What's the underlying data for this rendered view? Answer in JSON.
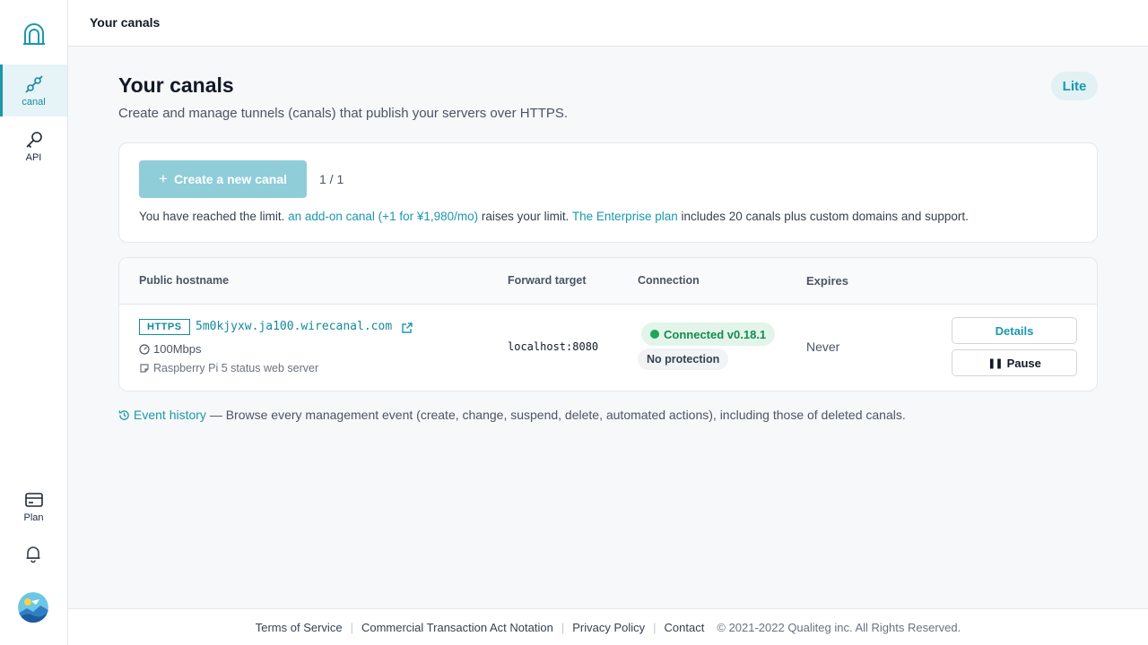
{
  "sidebar": {
    "logo_icon": "arch-logo-icon",
    "items": [
      {
        "label": "canal",
        "icon": "link-plug-icon",
        "active": true
      },
      {
        "label": "API",
        "icon": "key-icon",
        "active": false
      },
      {
        "label": "Plan",
        "icon": "card-icon",
        "active": false
      }
    ],
    "bell_icon": "bell-icon",
    "avatar_icon": "avatar-icon"
  },
  "topbar": {
    "title": "Your canals"
  },
  "main": {
    "title": "Your canals",
    "subtitle": "Create and manage tunnels (canals) that publish your servers over HTTPS.",
    "plan_badge": "Lite",
    "create": {
      "button_label": "Create a new canal",
      "count": "1 / 1",
      "limit_prefix": "You have reached the limit. ",
      "addon_link": "an add-on canal (+1 for ¥1,980/mo)",
      "limit_middle": " raises your limit. ",
      "enterprise_link": "The Enterprise plan",
      "limit_suffix": " includes 20 canals plus custom domains and support."
    },
    "table": {
      "headers": {
        "host": "Public hostname",
        "forward": "Forward target",
        "connection": "Connection",
        "expires": "Expires"
      },
      "rows": [
        {
          "protocol": "HTTPS",
          "hostname": "5m0kjyxw.ja100.wirecanal.com",
          "speed": "100Mbps",
          "description": "Raspberry Pi 5 status web server",
          "forward": "localhost:8080",
          "connection_status": "Connected v0.18.1",
          "protection": "No protection",
          "expires": "Never",
          "details_label": "Details",
          "pause_label": "Pause"
        }
      ]
    },
    "events": {
      "link": "Event history",
      "text": " — Browse every management event (create, change, suspend, delete, automated actions), including those of deleted canals."
    }
  },
  "footer": {
    "links": [
      "Terms of Service",
      "Commercial Transaction Act Notation",
      "Privacy Policy",
      "Contact"
    ],
    "copyright": "© 2021-2022 Qualiteg inc. All Rights Reserved."
  },
  "colors": {
    "accent": "#1a98ad",
    "connected": "#1ea55a",
    "create_button_disabled": "#8fcdd8"
  }
}
